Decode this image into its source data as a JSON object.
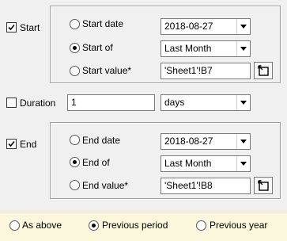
{
  "start": {
    "label": "Start",
    "checked": true,
    "options": {
      "date_label": "Start date",
      "of_label": "Start of",
      "value_label": "Start value*"
    },
    "selected": "of",
    "date_value": "2018-08-27",
    "of_value": "Last Month",
    "cell_value": "'Sheet1'!B7"
  },
  "duration": {
    "label": "Duration",
    "checked": false,
    "amount": "1",
    "unit": "days"
  },
  "end": {
    "label": "End",
    "checked": true,
    "options": {
      "date_label": "End date",
      "of_label": "End of",
      "value_label": "End value*"
    },
    "selected": "of",
    "date_value": "2018-08-27",
    "of_value": "Last Month",
    "cell_value": "'Sheet1'!B8"
  },
  "footer": {
    "options": [
      "As above",
      "Previous period",
      "Previous year"
    ],
    "selected": "Previous period"
  },
  "icons": {
    "checkbox_check": "check-mark",
    "dropdown": "chevron-down",
    "cell_picker": "range-selector"
  }
}
